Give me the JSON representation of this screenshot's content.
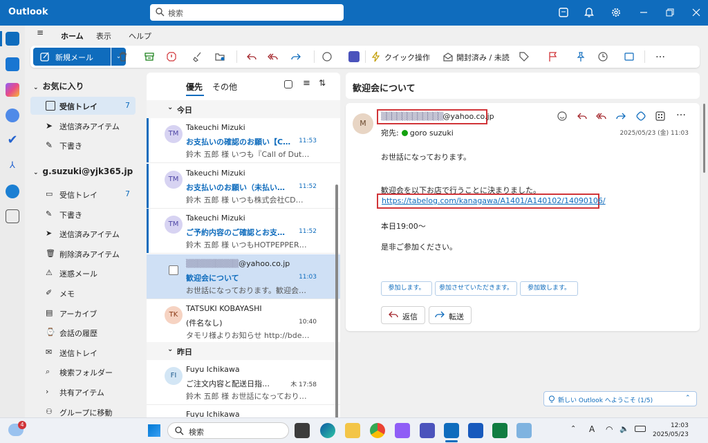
{
  "app": {
    "title": "Outlook",
    "search_placeholder": "検索"
  },
  "ribbon": {
    "tabs": [
      "ホーム",
      "表示",
      "ヘルプ"
    ],
    "new_mail": "新規メール",
    "quick_actions": "クイック操作",
    "mark_read": "開封済み / 未読"
  },
  "folders": {
    "favorites_header": "お気に入り",
    "favorites": [
      {
        "label": "受信トレイ",
        "count": "7",
        "icon": "inbox-icon"
      },
      {
        "label": "送信済みアイテム",
        "count": "",
        "icon": "send-icon"
      },
      {
        "label": "下書き",
        "count": "",
        "icon": "draft-icon"
      }
    ],
    "account_header": "g.suzuki@yjk365.jp",
    "account": [
      {
        "label": "受信トレイ",
        "count": "7",
        "icon": "inbox-icon"
      },
      {
        "label": "下書き",
        "count": "",
        "icon": "draft-icon"
      },
      {
        "label": "送信済みアイテム",
        "count": "",
        "icon": "send-icon"
      },
      {
        "label": "削除済みアイテム",
        "count": "",
        "icon": "trash-icon"
      },
      {
        "label": "迷惑メール",
        "count": "",
        "icon": "junk-icon"
      },
      {
        "label": "メモ",
        "count": "",
        "icon": "note-icon"
      },
      {
        "label": "アーカイブ",
        "count": "",
        "icon": "archive-icon"
      },
      {
        "label": "会話の履歴",
        "count": "",
        "icon": "history-folder-icon"
      },
      {
        "label": "送信トレイ",
        "count": "",
        "icon": "outbox-icon"
      },
      {
        "label": "検索フォルダー",
        "count": "",
        "icon": "search-folder-icon"
      },
      {
        "label": "共有アイテム",
        "count": "",
        "icon": "shared-icon"
      },
      {
        "label": "グループに移動",
        "count": "",
        "icon": "groups-icon"
      }
    ]
  },
  "message_list": {
    "tabs": [
      "優先",
      "その他"
    ],
    "group_today": "今日",
    "group_yesterday": "昨日",
    "messages": [
      {
        "initials": "TM",
        "from": "Takeuchi Mizuki",
        "subject": "お支払いの確認のお願い【C…",
        "time": "11:53",
        "preview": "鈴木 五郎 様 いつも『Call of Duty』…",
        "unread": true
      },
      {
        "initials": "TM",
        "from": "Takeuchi Mizuki",
        "subject": "お支払いのお願い（未払い…",
        "time": "11:52",
        "preview": "鈴木 五郎 様 いつも株式会社CDエ…",
        "unread": true
      },
      {
        "initials": "TM",
        "from": "Takeuchi Mizuki",
        "subject": "ご予約内容のご確認とお支…",
        "time": "11:52",
        "preview": "鈴木 五郎 様 いつもHOTPEPPERを…",
        "unread": true
      },
      {
        "initials": "",
        "from": "@yahoo.co.jp",
        "subject": "歓迎会について",
        "time": "11:03",
        "preview": "お世話になっております。歓迎会を以…",
        "unread": false
      },
      {
        "initials": "TK",
        "from": "TATSUKI KOBAYASHI",
        "subject": "(件名なし)",
        "time": "10:40",
        "preview": "タモリ様よりお知らせ http://bde.jp/…",
        "unread": false
      },
      {
        "initials": "FI",
        "from": "Fuyu Ichikawa",
        "subject": "ご注文内容と配送日指…",
        "time": "木 17:58",
        "preview": "鈴木 五郎 様 お世話になっております…",
        "unread": false
      },
      {
        "initials": "",
        "from": "Fuyu Ichikawa",
        "subject": "",
        "time": "",
        "preview": "",
        "unread": false
      }
    ]
  },
  "reading": {
    "subject": "歓迎会について",
    "avatar": "M",
    "from_domain": "@yahoo.co.jp",
    "to_label": "宛先:",
    "to_name": "goro suzuki",
    "date": "2025/05/23 (金) 11:03",
    "body": [
      "お世話になっております。",
      "歓迎会を以下お店で行うことに決まりました。",
      "本日19:00〜",
      "是非ご参加ください。"
    ],
    "link": "https://tabelog.com/kanagawa/A1401/A140102/14090106/",
    "suggested_replies": [
      "参加します。",
      "参加させていただきます。",
      "参加致します。"
    ],
    "reply": "返信",
    "forward": "転送"
  },
  "welcome_banner": "新しい Outlook へようこそ (1/5)",
  "taskbar": {
    "search": "検索",
    "time": "12:03",
    "date": "2025/05/23",
    "badge": "4",
    "ime": "A"
  },
  "colors": {
    "accent": "#0f6cbd",
    "highlight_box": "#d13438"
  }
}
